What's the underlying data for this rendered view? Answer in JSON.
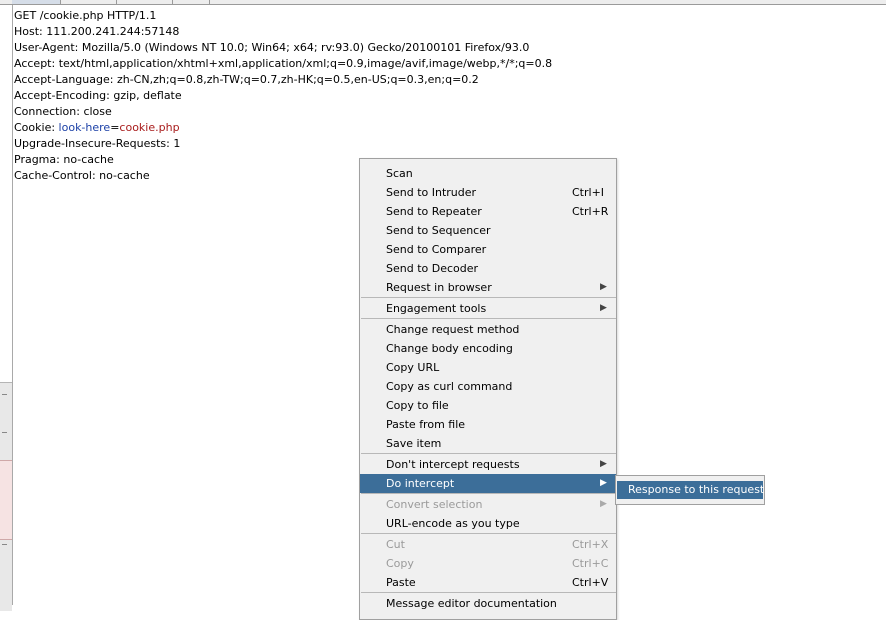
{
  "request": {
    "lines": [
      "GET /cookie.php HTTP/1.1",
      "Host: 111.200.241.244:57148",
      "User-Agent: Mozilla/5.0 (Windows NT 10.0; Win64; x64; rv:93.0) Gecko/20100101 Firefox/93.0",
      "Accept: text/html,application/xhtml+xml,application/xml;q=0.9,image/avif,image/webp,*/*;q=0.8",
      "Accept-Language: zh-CN,zh;q=0.8,zh-TW;q=0.7,zh-HK;q=0.5,en-US;q=0.3,en;q=0.2",
      "Accept-Encoding: gzip, deflate",
      "Connection: close"
    ],
    "cookie": {
      "prefix": "Cookie: ",
      "name": "look-here",
      "eq": "=",
      "value": "cookie.php"
    },
    "lines_after": [
      "Upgrade-Insecure-Requests: 1",
      "Pragma: no-cache",
      "Cache-Control: no-cache"
    ]
  },
  "context_menu": {
    "items": [
      {
        "label": "Scan"
      },
      {
        "label": "Send to Intruder",
        "shortcut": "Ctrl+I"
      },
      {
        "label": "Send to Repeater",
        "shortcut": "Ctrl+R"
      },
      {
        "label": "Send to Sequencer"
      },
      {
        "label": "Send to Comparer"
      },
      {
        "label": "Send to Decoder"
      },
      {
        "label": "Request in browser",
        "submenu": true
      },
      {
        "separator": true
      },
      {
        "label": "Engagement tools",
        "submenu": true
      },
      {
        "separator": true
      },
      {
        "label": "Change request method"
      },
      {
        "label": "Change body encoding"
      },
      {
        "label": "Copy URL"
      },
      {
        "label": "Copy as curl command"
      },
      {
        "label": "Copy to file"
      },
      {
        "label": "Paste from file"
      },
      {
        "label": "Save item"
      },
      {
        "separator": true
      },
      {
        "label": "Don't intercept requests",
        "submenu": true
      },
      {
        "label": "Do intercept",
        "submenu": true,
        "highlighted": true
      },
      {
        "separator": true
      },
      {
        "label": "Convert selection",
        "submenu": true,
        "disabled": true
      },
      {
        "label": "URL-encode as you type"
      },
      {
        "separator": true
      },
      {
        "label": "Cut",
        "shortcut": "Ctrl+X",
        "disabled": true
      },
      {
        "label": "Copy",
        "shortcut": "Ctrl+C",
        "disabled": true
      },
      {
        "label": "Paste",
        "shortcut": "Ctrl+V"
      },
      {
        "separator": true
      },
      {
        "label": "Message editor documentation"
      }
    ]
  },
  "submenu": {
    "item": "Response to this request"
  },
  "icons": {
    "submenu_arrow": "triangle-right-icon"
  },
  "colors": {
    "highlight": "#3c6e99",
    "cookie_name": "#1a3fa6",
    "cookie_value": "#a81b1b"
  }
}
